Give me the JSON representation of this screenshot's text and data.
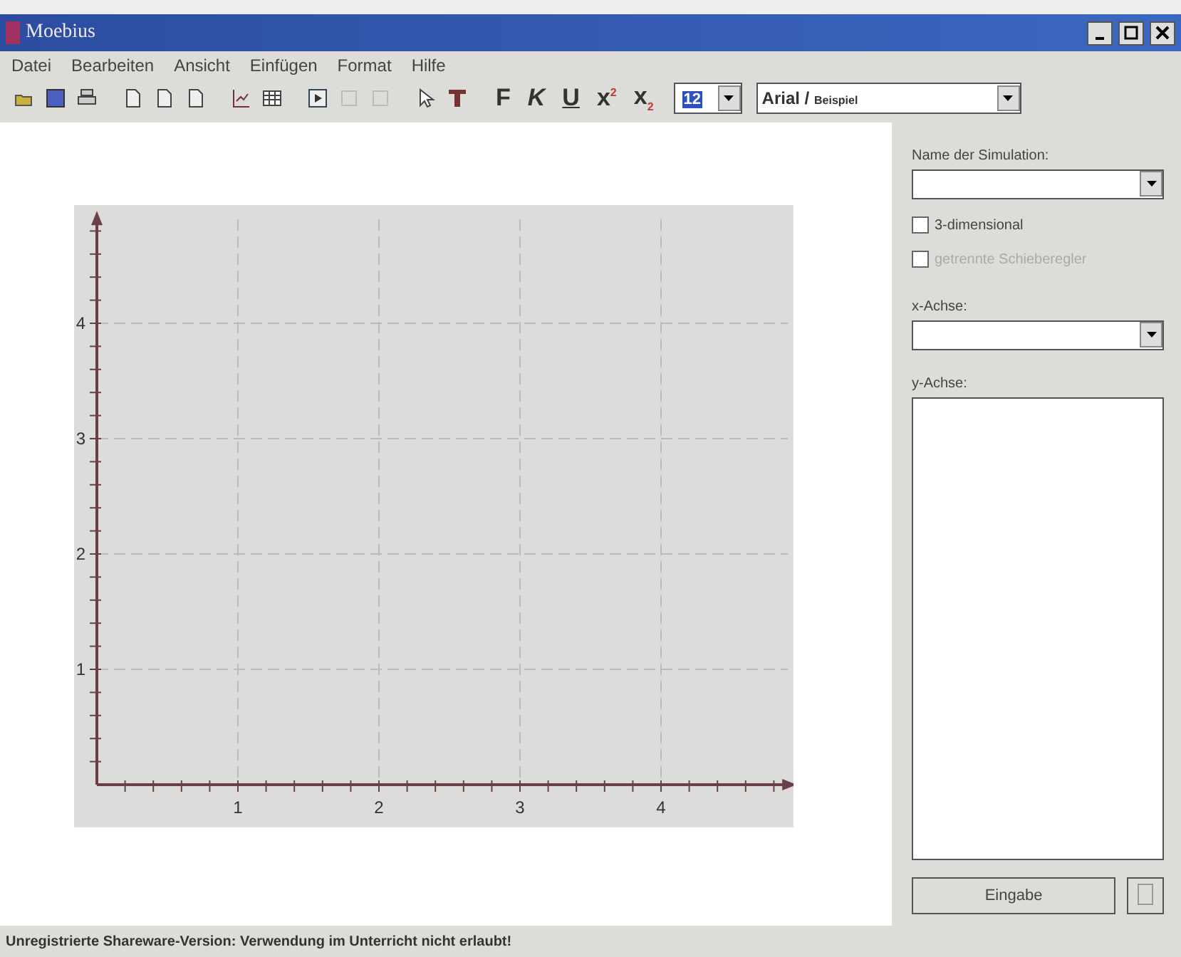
{
  "window": {
    "title": "Moebius"
  },
  "menu": [
    "Datei",
    "Bearbeiten",
    "Ansicht",
    "Einfügen",
    "Format",
    "Hilfe"
  ],
  "toolbar": {
    "format_buttons": [
      {
        "kind": "bold",
        "label": "F"
      },
      {
        "kind": "italic",
        "label": "K"
      },
      {
        "kind": "underline",
        "label": "U"
      },
      {
        "kind": "sup",
        "label": "x",
        "mark": "2"
      },
      {
        "kind": "sub",
        "label": "x",
        "mark": "2"
      }
    ],
    "font_size": "12",
    "font": {
      "name": "Arial /",
      "sample": "Beispiel"
    }
  },
  "chart": {
    "chart_data": {
      "type": "line",
      "xlim": [
        0,
        4.9
      ],
      "ylim": [
        0,
        4.9
      ],
      "xticks": [
        1,
        2,
        3,
        4
      ],
      "yticks": [
        1,
        2,
        3,
        4
      ],
      "grid": true
    }
  },
  "panel": {
    "name_label": "Name der Simulation:",
    "checkboxes": [
      {
        "label": "3-dimensional",
        "checked": false,
        "disabled": false
      },
      {
        "label": "getrennte Schieberegler",
        "checked": false,
        "disabled": true
      }
    ],
    "x_label": "x-Achse:",
    "y_label": "y-Achse:",
    "submit": "Eingabe"
  },
  "status_bar": "Unregistrierte Shareware-Version: Verwendung im Unterricht nicht erlaubt!"
}
